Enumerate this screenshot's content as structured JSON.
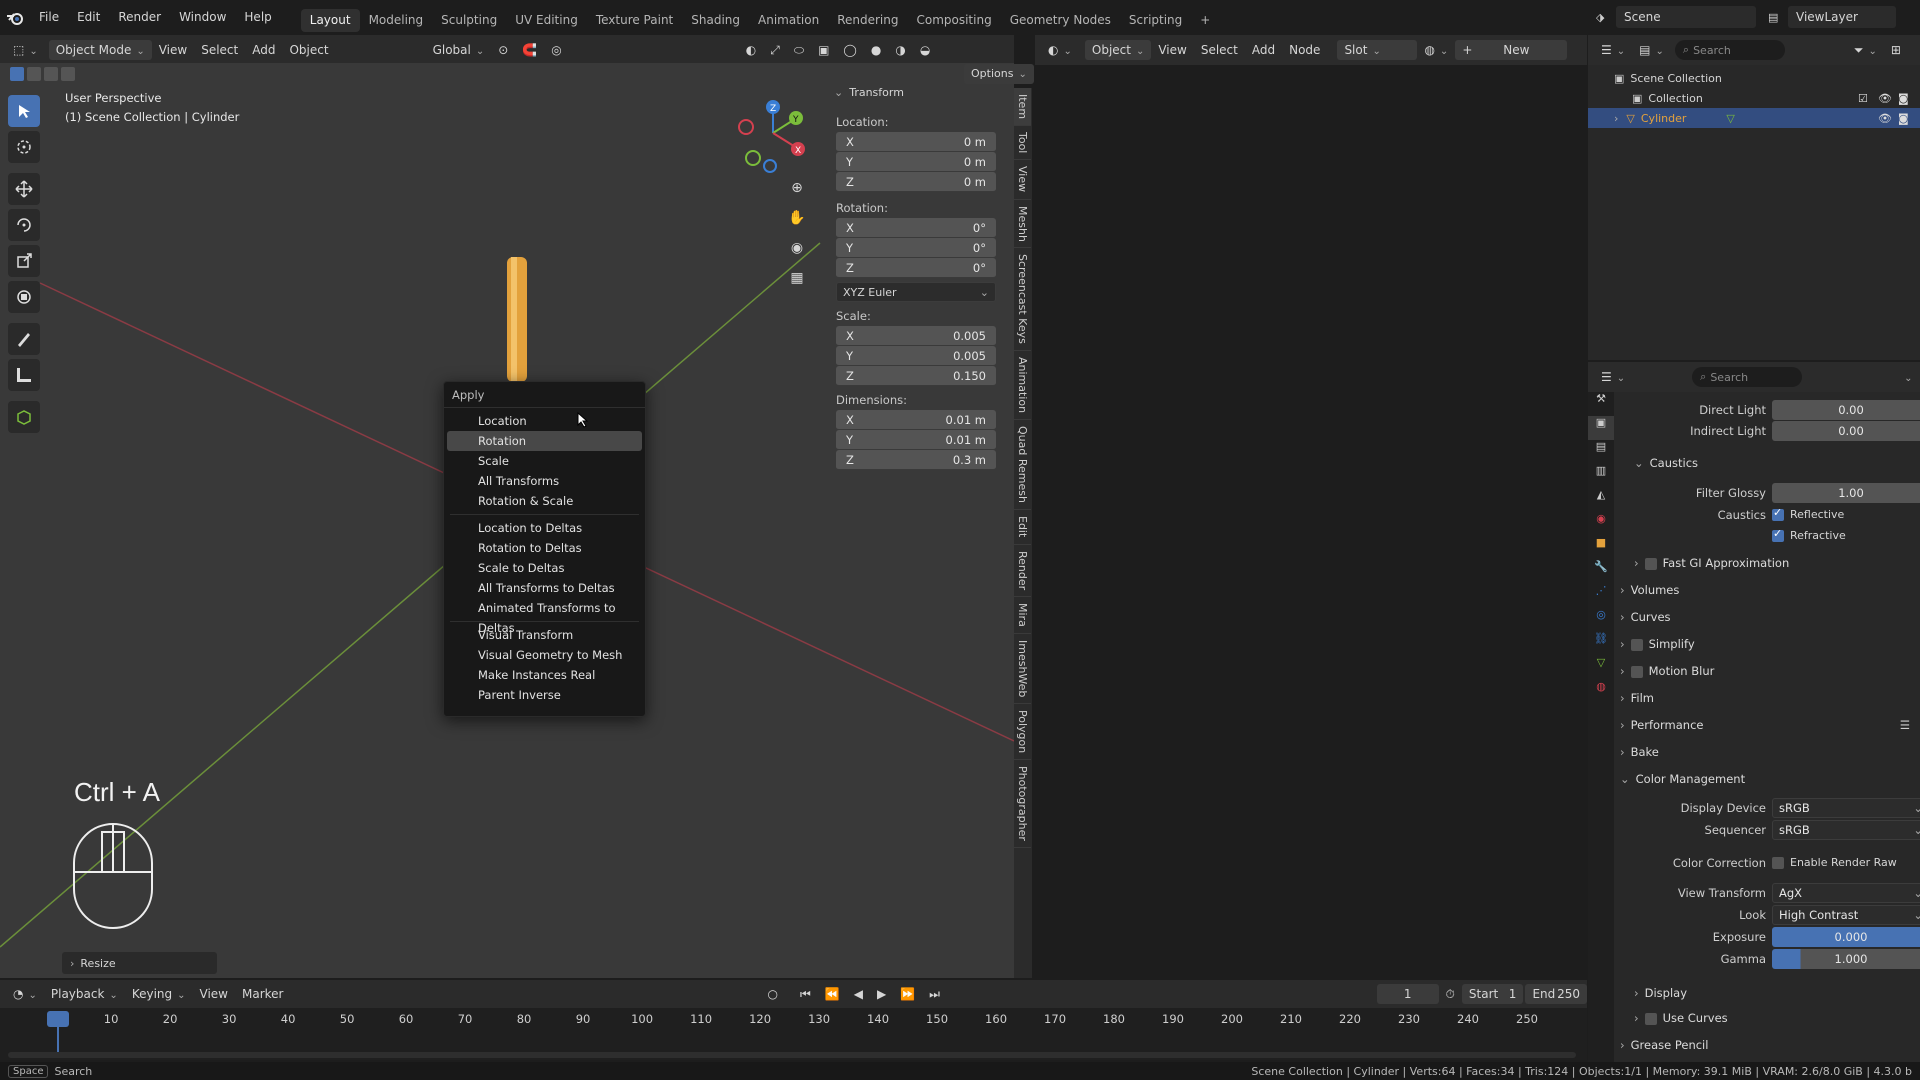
{
  "topbar": {
    "menus": [
      "File",
      "Edit",
      "Render",
      "Window",
      "Help"
    ],
    "workspaces": [
      "Layout",
      "Modeling",
      "Sculpting",
      "UV Editing",
      "Texture Paint",
      "Shading",
      "Animation",
      "Rendering",
      "Compositing",
      "Geometry Nodes",
      "Scripting"
    ],
    "active_workspace": "Layout",
    "add_tab": "+",
    "scene": "Scene",
    "view_layer": "ViewLayer"
  },
  "viewport_header": {
    "mode": "Object Mode",
    "menus": [
      "View",
      "Select",
      "Add",
      "Object"
    ],
    "orientation": "Global",
    "options": "Options"
  },
  "viewport": {
    "perspective": "User Perspective",
    "context": "(1) Scene Collection | Cylinder",
    "shortcut": "Ctrl + A",
    "last_op": "Resize"
  },
  "apply_menu": {
    "title": "Apply",
    "group1": [
      "Location",
      "Rotation",
      "Scale",
      "All Transforms",
      "Rotation & Scale"
    ],
    "group2": [
      "Location to Deltas",
      "Rotation to Deltas",
      "Scale to Deltas",
      "All Transforms to Deltas",
      "Animated Transforms to Deltas"
    ],
    "group3": [
      "Visual Transform",
      "Visual Geometry to Mesh",
      "Make Instances Real",
      "Parent Inverse"
    ],
    "highlighted": "Rotation"
  },
  "npanel": {
    "title": "Transform",
    "location_label": "Location:",
    "location": [
      {
        "axis": "X",
        "value": "0 m"
      },
      {
        "axis": "Y",
        "value": "0 m"
      },
      {
        "axis": "Z",
        "value": "0 m"
      }
    ],
    "rotation_label": "Rotation:",
    "rotation": [
      {
        "axis": "X",
        "value": "0°"
      },
      {
        "axis": "Y",
        "value": "0°"
      },
      {
        "axis": "Z",
        "value": "0°"
      }
    ],
    "rotation_mode": "XYZ Euler",
    "scale_label": "Scale:",
    "scale": [
      {
        "axis": "X",
        "value": "0.005"
      },
      {
        "axis": "Y",
        "value": "0.005"
      },
      {
        "axis": "Z",
        "value": "0.150"
      }
    ],
    "dimensions_label": "Dimensions:",
    "dimensions": [
      {
        "axis": "X",
        "value": "0.01 m"
      },
      {
        "axis": "Y",
        "value": "0.01 m"
      },
      {
        "axis": "Z",
        "value": "0.3 m"
      }
    ],
    "side_tabs": [
      "Item",
      "Tool",
      "View",
      "Meshh",
      "Screencast Keys",
      "Animation",
      "Quad Remesh",
      "Edit",
      "Render",
      "Mira",
      "ImeshWeb",
      "Polygon",
      "Photographer"
    ]
  },
  "node_header": {
    "object": "Object",
    "menus": [
      "View",
      "Select",
      "Add",
      "Node"
    ],
    "slot": "Slot",
    "new": "New"
  },
  "outliner": {
    "search_placeholder": "Search",
    "scene_collection": "Scene Collection",
    "collection": "Collection",
    "object": "Cylinder"
  },
  "properties": {
    "search_placeholder": "Search",
    "direct_light_label": "Direct Light",
    "direct_light": "0.00",
    "indirect_light_label": "Indirect Light",
    "indirect_light": "0.00",
    "caustics_section": "Caustics",
    "filter_glossy_label": "Filter Glossy",
    "filter_glossy": "1.00",
    "caustics_label": "Caustics",
    "reflective": "Reflective",
    "refractive": "Refractive",
    "fast_gi": "Fast GI Approximation",
    "sections": [
      "Volumes",
      "Curves",
      "Simplify",
      "Motion Blur",
      "Film",
      "Performance",
      "Bake"
    ],
    "color_management": "Color Management",
    "display_device_label": "Display Device",
    "display_device": "sRGB",
    "sequencer_label": "Sequencer",
    "sequencer": "sRGB",
    "color_correction_label": "Color Correction",
    "enable_render_raw": "Enable Render Raw",
    "view_transform_label": "View Transform",
    "view_transform": "AgX",
    "look_label": "Look",
    "look": "High Contrast",
    "exposure_label": "Exposure",
    "exposure": "0.000",
    "gamma_label": "Gamma",
    "gamma": "1.000",
    "display": "Display",
    "use_curves": "Use Curves",
    "grease_pencil": "Grease Pencil"
  },
  "timeline": {
    "menus": [
      "Playback",
      "Keying",
      "View",
      "Marker"
    ],
    "current_frame": "1",
    "start_label": "Start",
    "start": "1",
    "end_label": "End",
    "end": "250",
    "ticks": [
      "1",
      "10",
      "20",
      "30",
      "40",
      "50",
      "60",
      "70",
      "80",
      "90",
      "100",
      "110",
      "120",
      "130",
      "140",
      "150",
      "160",
      "170",
      "180",
      "190",
      "200",
      "210",
      "220",
      "230",
      "240",
      "250"
    ]
  },
  "statusbar": {
    "key": "Space",
    "action": "Search",
    "info": "Scene Collection | Cylinder | Verts:64 | Faces:34 | Tris:124 | Objects:1/1 | Memory: 39.1 MiB | VRAM: 2.6/8.0 GiB | 4.3.0 b"
  },
  "colors": {
    "accent": "#4772b3",
    "object_orange": "#e3a13c",
    "x_axis": "#d4404f",
    "y_axis": "#7bbd3b",
    "z_axis": "#3a7fd6"
  }
}
